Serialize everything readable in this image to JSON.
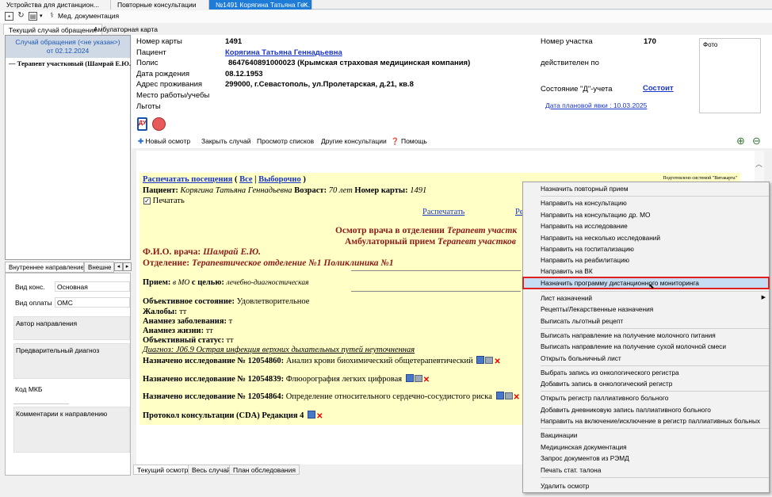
{
  "top_tabs": [
    {
      "label": "Устройства для дистанцион..."
    },
    {
      "label": "Повторные консультации"
    },
    {
      "label": "№1491 Корягина Татьяна Ге..."
    }
  ],
  "toolbar": {
    "med_docs": "Мед. документация"
  },
  "sub_tabs": [
    "Текущий случай обращения",
    "Амбулаторная карта"
  ],
  "case": {
    "line1": "Случай обращения (<не указан>)",
    "line2": "от 02.12.2024",
    "tree_item": "Терапевт участковый (Шамрай Е.Ю."
  },
  "lower_tabs": [
    "Внутреннее направление",
    "Внешне"
  ],
  "referral": {
    "kind_label": "Вид конс.",
    "kind_value": "Основная",
    "pay_label": "Вид оплаты",
    "pay_value": "ОМС",
    "author_label": "Автор направления",
    "prelim_label": "Предварительный диагноз",
    "mkb_label": "Код МКБ",
    "comments_label": "Комментарии к направлению"
  },
  "patient": {
    "card_label": "Номер карты",
    "card_value": "1491",
    "patient_label": "Пациент",
    "patient_value": "Корягина Татьяна Геннадьевна",
    "policy_label": "Полис",
    "policy_value": "8647640891000023 (Крымская страховая медицинская компания)",
    "dob_label": "Дата рождения",
    "dob_value": "08.12.1953",
    "address_label": "Адрес проживания",
    "address_value": "299000, г.Севастополь, ул.Пролетарская, д.21, кв.8",
    "work_label": "Место работы/учебы",
    "benefits_label": "Льготы",
    "district_label": "Номер участка",
    "district_value": "170",
    "valid_label": "действителен по",
    "d_label": "Состояние \"Д\"-учета",
    "d_value": "Состоит",
    "planned_visit": "Дата плановой явки : 10.03.2025",
    "photo_label": "Фото"
  },
  "actions": {
    "new_exam": "Новый осмотр",
    "close_case": "Закрыть случай",
    "view_lists": "Просмотр списков",
    "other_consults": "Другие консультации",
    "help": "Помощь"
  },
  "document": {
    "prepared": "Подготовлено системой \"Витакарта\"",
    "print_visits": "Распечатать посещения",
    "paren_open": "(",
    "all": "Все",
    "sep": "|",
    "selective": "Выборочно",
    "paren_close": ")",
    "patient_label": "Пациент:",
    "patient_name": "Корягина Татьяна Геннадьевна",
    "age_label": "Возраст:",
    "age_value": "70 лет",
    "card_label": "Номер карты:",
    "card_value": "1491",
    "print_check": "Печатать",
    "print_link": "Распечатать",
    "print_link2": "Ре",
    "exam_title": "Осмотр врача в отделении",
    "exam_title_it": "Терапевт участк",
    "amb_title": "Амбулаторный прием",
    "amb_title_it": "Терапевт участков",
    "doctor_label": "Ф.И.О. врача:",
    "doctor_value": "Шамрай Е.Ю.",
    "dept_label": "Отделение:",
    "dept_value": "Терапевтическое отделение №1 Поликлиника №1",
    "reception_label": "Прием:",
    "reception_place": "в МО",
    "reception_mid": "с целью:",
    "reception_purpose": "лечебно-диагностическая",
    "objective_label": "Объективное состояние:",
    "objective_value": "Удовлетворительное",
    "complaints_label": "Жалобы:",
    "complaints_value": "тт",
    "anamnesis_label": "Анамнез заболевания:",
    "anamnesis_value": "т",
    "life_label": "Анамнез жизни:",
    "life_value": "тт",
    "status_label": "Объективный статус:",
    "status_value": "тт",
    "diagnosis": "Диагноз: J06.9 Острая инфекция верхних дыхательных путей неуточненная",
    "study1_label": "Назначено исследование № 12054860:",
    "study1_value": "Анализ крови биохимический общетерапевтический",
    "study2_label": "Назначено исследование № 12054839:",
    "study2_value": "Флюорография легких цифровая",
    "study3_label": "Назначено исследование № 12054864:",
    "study3_value": "Определение относительного сердечно-сосудистого риска",
    "protocol": "Протокол консультации (CDA) Редакция 4"
  },
  "bottom_tabs": [
    "Текущий осмотр",
    "Весь случай",
    "План обследования"
  ],
  "context_menu": [
    {
      "label": "Назначить повторный прием"
    },
    {
      "label": "Направить на консультацию"
    },
    {
      "label": "Направить на консультацию др. МО"
    },
    {
      "label": "Направить на исследование"
    },
    {
      "label": "Направить на несколько исследований"
    },
    {
      "label": "Направить на госпитализацию"
    },
    {
      "label": "Направить на реабилитацию"
    },
    {
      "label": "Направить на ВК"
    },
    {
      "label": "Назначить программу дистанционного мониторинга"
    },
    {
      "label": "Лист назначений"
    },
    {
      "label": "Рецепты/Лекарственные назначения"
    },
    {
      "label": "Выписать льготный рецепт"
    },
    {
      "label": "Выписать направление на получение молочного питания"
    },
    {
      "label": "Выписать направление на получение сухой молочной смеси"
    },
    {
      "label": "Открыть больничный лист"
    },
    {
      "label": "Выбрать запись из онкологического регистра"
    },
    {
      "label": "Добавить запись в онкологический регистр"
    },
    {
      "label": "Открыть регистр паллиативного больного"
    },
    {
      "label": "Добавить дневниковую запись паллиативного больного"
    },
    {
      "label": "Направить на включение/исключение в регистр паллиативных больных"
    },
    {
      "label": "Вакцинации"
    },
    {
      "label": "Медицинская документация"
    },
    {
      "label": "Запрос документов из РЭМД"
    },
    {
      "label": "Печать стат. талона"
    },
    {
      "label": "Удалить осмотр"
    }
  ]
}
